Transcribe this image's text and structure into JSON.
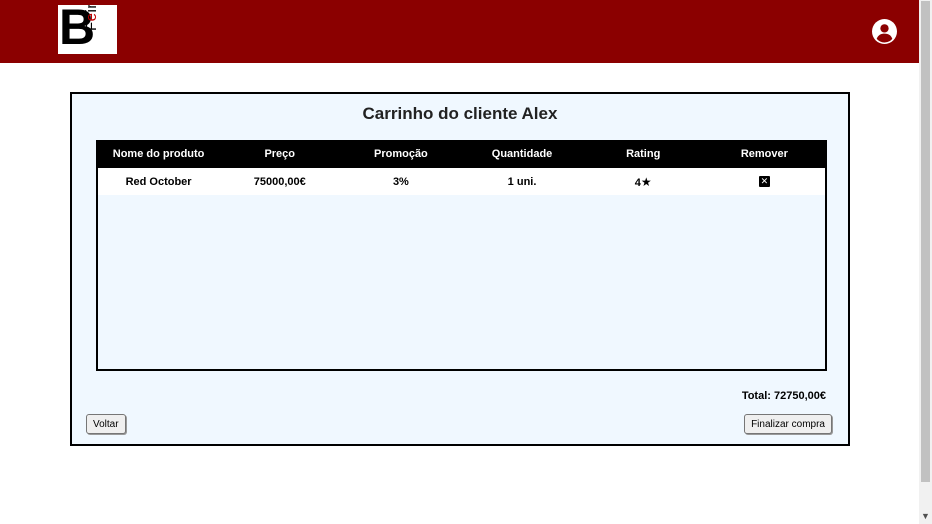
{
  "header": {
    "logo": {
      "letter": "B",
      "word_black_1": "F",
      "word_red": "e",
      "word_black_2": "ira"
    }
  },
  "cart": {
    "title": "Carrinho do cliente Alex",
    "columns": [
      "Nome do produto",
      "Preço",
      "Promoção",
      "Quantidade",
      "Rating",
      "Remover"
    ],
    "rows": [
      {
        "name": "Red October",
        "price": "75000,00€",
        "promo": "3%",
        "quantity": "1 uni.",
        "rating": "4",
        "remove_icon": "close-icon"
      }
    ],
    "total": "Total: 72750,00€",
    "back_label": "Voltar",
    "checkout_label": "Finalizar compra"
  },
  "colors": {
    "brand": "#8b0000",
    "panel": "#f0f8ff"
  }
}
